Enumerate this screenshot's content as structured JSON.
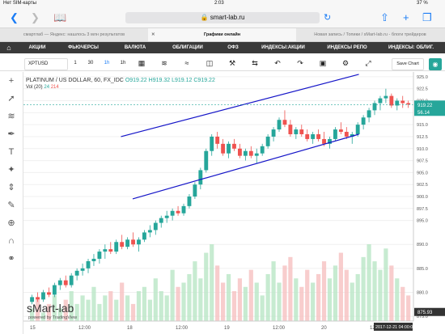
{
  "status_bar": {
    "carrier": "Нет SIM-карты",
    "time": "2:03",
    "battery": "37 %"
  },
  "browser": {
    "url": "smart-lab.ru",
    "url_lock_icon": "lock-icon"
  },
  "tabs": [
    {
      "label": "смартлаб — Яндекс: нашлось 3 млн результатов",
      "active": false
    },
    {
      "label": "Графики онлайн",
      "active": true
    },
    {
      "label": "Новая запись / Топики / sMart-lab.ru - блоги трейдеров",
      "active": false
    }
  ],
  "nav": {
    "home_icon": "home-icon",
    "items": [
      "АКЦИИ",
      "ФЬЮЧЕРСЫ",
      "ВАЛЮТА",
      "ОБЛИГАЦИИ",
      "ОФЗ",
      "ИНДЕКСЫ:АКЦИИ",
      "ИНДЕКСЫ РЕПО",
      "ИНДЕКСЫ: ОБЛИГ."
    ]
  },
  "toolbar": {
    "symbol": "XPTUSD",
    "intervals": [
      "1",
      "30",
      "1h",
      "1h"
    ],
    "save_chart": "Save Chart"
  },
  "legend": {
    "title": "PLATINUM / US DOLLAR, 60, FX_IDC",
    "o_label": "O",
    "o_value": "919.22",
    "h_label": "H",
    "h_value": "919.32",
    "l_label": "L",
    "l_value": "919.12",
    "c_label": "C",
    "c_value": "919.22",
    "vol_label": "Vol (20)",
    "vol_a": "24",
    "vol_b": "214"
  },
  "price_tags": {
    "last": "919.22",
    "vol": "56.14",
    "cursor": "875.93"
  },
  "time_tag": "2017-12-21 04:00:00",
  "logo": {
    "name": "sMart-lab",
    "powered": "powered by TradingView"
  },
  "colors": {
    "up": "#26a69a",
    "down": "#ef5350",
    "channel": "#1515c8",
    "nav_bg": "#3a3a3a",
    "accent": "#1a7cf5"
  },
  "chart_data": {
    "type": "candlestick",
    "y_ticks": [
      875.0,
      880.0,
      885.0,
      890.0,
      895.0,
      897.5,
      900.0,
      902.5,
      905.0,
      907.5,
      910.0,
      912.5,
      915.0,
      917.5,
      920.0,
      922.5,
      925.0
    ],
    "ylim": [
      874,
      926
    ],
    "x_ticks": [
      "15",
      "12:00",
      "18",
      "12:00",
      "19",
      "12:00",
      "20",
      "12:00"
    ],
    "candles": [
      [
        878.0,
        879.5,
        877.5,
        879.0
      ],
      [
        879.0,
        880.0,
        878.0,
        878.5
      ],
      [
        878.5,
        880.5,
        878.0,
        880.0
      ],
      [
        880.0,
        881.0,
        879.0,
        879.5
      ],
      [
        879.5,
        882.0,
        879.0,
        881.5
      ],
      [
        881.5,
        883.0,
        880.5,
        882.5
      ],
      [
        882.5,
        883.5,
        881.0,
        881.5
      ],
      [
        881.5,
        884.0,
        881.0,
        883.5
      ],
      [
        883.5,
        885.0,
        882.5,
        884.5
      ],
      [
        884.5,
        886.0,
        883.5,
        885.0
      ],
      [
        885.0,
        887.0,
        884.0,
        886.5
      ],
      [
        886.5,
        888.0,
        885.5,
        887.0
      ],
      [
        887.0,
        889.0,
        886.0,
        888.5
      ],
      [
        888.5,
        890.0,
        887.0,
        889.0
      ],
      [
        889.0,
        890.5,
        888.0,
        888.5
      ],
      [
        888.5,
        891.0,
        888.0,
        890.5
      ],
      [
        890.5,
        892.0,
        889.0,
        889.5
      ],
      [
        889.5,
        891.5,
        889.0,
        891.0
      ],
      [
        891.0,
        892.5,
        889.5,
        890.0
      ],
      [
        890.0,
        891.5,
        888.5,
        891.0
      ],
      [
        891.0,
        893.0,
        890.5,
        892.5
      ],
      [
        892.5,
        894.0,
        891.5,
        893.0
      ],
      [
        893.0,
        895.0,
        892.0,
        894.5
      ],
      [
        894.5,
        896.0,
        893.5,
        895.5
      ],
      [
        895.5,
        897.0,
        894.5,
        896.0
      ],
      [
        896.0,
        897.5,
        895.0,
        897.0
      ],
      [
        897.0,
        898.0,
        896.0,
        896.5
      ],
      [
        896.5,
        898.5,
        896.0,
        898.0
      ],
      [
        898.0,
        900.5,
        897.5,
        900.0
      ],
      [
        900.0,
        903.0,
        899.5,
        902.5
      ],
      [
        902.5,
        906.0,
        901.5,
        905.5
      ],
      [
        905.5,
        910.0,
        905.0,
        909.5
      ],
      [
        909.5,
        913.0,
        908.5,
        912.5
      ],
      [
        912.5,
        913.5,
        910.0,
        911.0
      ],
      [
        911.0,
        912.0,
        908.5,
        909.0
      ],
      [
        909.0,
        911.5,
        908.0,
        911.0
      ],
      [
        911.0,
        912.0,
        909.5,
        910.0
      ],
      [
        910.0,
        911.0,
        908.0,
        908.5
      ],
      [
        908.5,
        910.0,
        907.5,
        909.5
      ],
      [
        909.5,
        910.5,
        908.0,
        908.5
      ],
      [
        908.5,
        910.0,
        907.0,
        909.0
      ],
      [
        909.0,
        911.0,
        908.5,
        910.5
      ],
      [
        910.5,
        913.0,
        910.0,
        912.5
      ],
      [
        912.5,
        914.5,
        911.5,
        914.0
      ],
      [
        914.0,
        916.5,
        913.5,
        916.0
      ],
      [
        916.0,
        918.0,
        914.5,
        915.0
      ],
      [
        915.0,
        916.0,
        912.5,
        913.0
      ],
      [
        913.0,
        914.5,
        912.0,
        914.0
      ],
      [
        914.0,
        915.0,
        912.5,
        913.0
      ],
      [
        913.0,
        914.0,
        911.5,
        912.0
      ],
      [
        912.0,
        913.5,
        911.0,
        913.0
      ],
      [
        913.0,
        914.0,
        911.5,
        912.0
      ],
      [
        912.0,
        913.5,
        910.5,
        911.0
      ],
      [
        911.0,
        912.5,
        910.0,
        912.0
      ],
      [
        912.0,
        914.5,
        911.5,
        914.0
      ],
      [
        914.0,
        915.5,
        913.0,
        913.5
      ],
      [
        913.5,
        914.5,
        912.0,
        912.5
      ],
      [
        912.5,
        913.5,
        911.0,
        913.0
      ],
      [
        913.0,
        915.5,
        912.5,
        915.0
      ],
      [
        915.0,
        917.0,
        914.0,
        916.5
      ],
      [
        916.5,
        918.5,
        915.5,
        918.0
      ],
      [
        918.0,
        920.0,
        917.0,
        919.5
      ],
      [
        919.5,
        921.0,
        918.0,
        920.5
      ],
      [
        920.5,
        922.5,
        919.5,
        921.0
      ],
      [
        921.0,
        921.5,
        918.5,
        919.0
      ],
      [
        919.0,
        920.5,
        918.0,
        920.0
      ],
      [
        920.0,
        921.0,
        918.5,
        919.5
      ],
      [
        919.5,
        920.0,
        918.5,
        919.2
      ]
    ],
    "volumes": [
      3,
      5,
      2,
      4,
      6,
      3,
      5,
      7,
      4,
      6,
      5,
      8,
      4,
      6,
      7,
      5,
      9,
      6,
      4,
      7,
      8,
      5,
      10,
      7,
      6,
      12,
      8,
      9,
      11,
      14,
      10,
      16,
      18,
      13,
      9,
      11,
      7,
      10,
      8,
      12,
      9,
      6,
      11,
      14,
      9,
      13,
      15,
      10,
      8,
      12,
      9,
      11,
      14,
      10,
      13,
      16,
      12,
      9,
      11,
      15,
      18,
      14,
      12,
      17,
      13,
      10,
      8,
      6
    ],
    "channel_upper": [
      [
        0.25,
        912.5
      ],
      [
        0.86,
        925.5
      ]
    ],
    "channel_lower": [
      [
        0.28,
        899.5
      ],
      [
        0.86,
        913.0
      ]
    ]
  }
}
